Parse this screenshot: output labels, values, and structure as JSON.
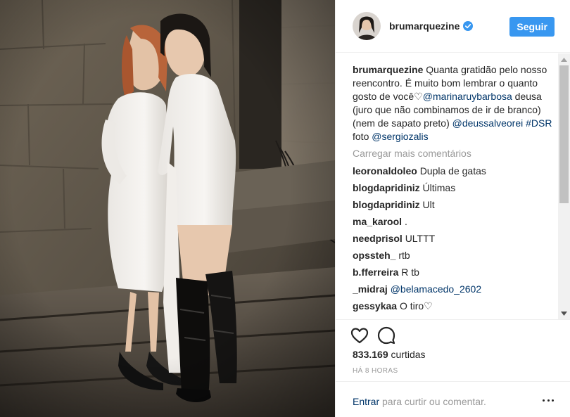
{
  "header": {
    "username": "brumarquezine",
    "follow_label": "Seguir"
  },
  "caption": {
    "author": "brumarquezine",
    "text_1": "Quanta gratidão pelo nosso reencontro. É muito bom lembrar o quanto gosto de você♡",
    "mention_1": "@marinaruybarbosa",
    "text_2": "deusa (juro que não combinamos de ir de branco) (nem de sapato preto)",
    "mention_2": "@deussalveorei",
    "hashtag": "#DSR",
    "text_3": "foto",
    "mention_3": "@sergiozalis"
  },
  "load_more_label": "Carregar mais comentários",
  "comments": [
    {
      "author": "leoronaldoleo",
      "text": "Dupla de gatas",
      "is_link": false
    },
    {
      "author": "blogdapridiniz",
      "text": "Últimas",
      "is_link": false
    },
    {
      "author": "blogdapridiniz",
      "text": "Ult",
      "is_link": false
    },
    {
      "author": "ma_karool",
      "text": ".",
      "is_link": false
    },
    {
      "author": "needprisol",
      "text": "ULTTT",
      "is_link": false
    },
    {
      "author": "opssteh_",
      "text": "rtb",
      "is_link": false
    },
    {
      "author": "b.fferreira",
      "text": "R tb",
      "is_link": false
    },
    {
      "author": "_midraj",
      "text": "@belamacedo_2602",
      "is_link": true
    },
    {
      "author": "gessykaa",
      "text": "O tiro♡",
      "is_link": false
    }
  ],
  "likes": {
    "count": "833.169",
    "label": "curtidas"
  },
  "timestamp": "HÁ 8 HORAS",
  "add_comment": {
    "login_label": "Entrar",
    "prompt": "para curtir ou comentar."
  },
  "icons": {
    "like": "heart-outline-icon",
    "comment": "speech-bubble-icon",
    "verified": "verified-badge-icon",
    "more": "more-options-icon"
  },
  "colors": {
    "follow_button": "#3897f0",
    "link": "#003569",
    "muted": "#999999",
    "verified": "#3897f0"
  }
}
